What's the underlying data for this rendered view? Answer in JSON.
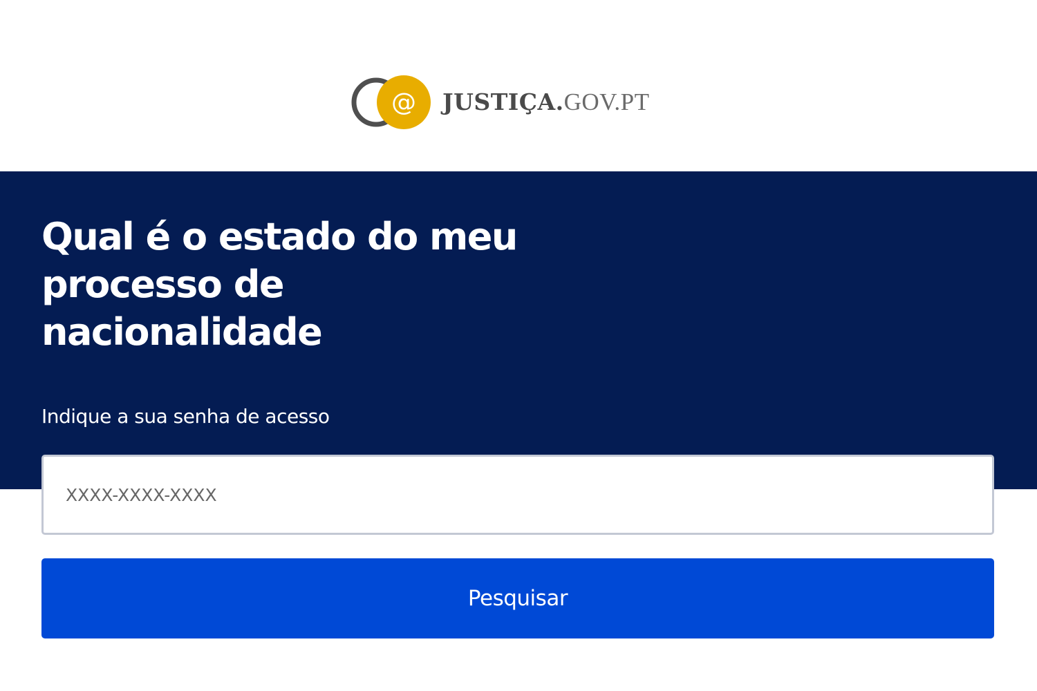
{
  "logo": {
    "icon": "justica-at-logo-icon",
    "brand": "JUSTIÇA.",
    "domain": "GOV.PT",
    "colors": {
      "ring": "#4f4f4f",
      "circle": "#e8ad00",
      "at_symbol": "#ffffff"
    }
  },
  "hero": {
    "title": "Qual é o estado do meu processo de nacionalidade",
    "background_color": "#041c53"
  },
  "form": {
    "label": "Indique a sua senha de acesso",
    "input_placeholder": "XXXX-XXXX-XXXX",
    "input_value": "",
    "submit_label": "Pesquisar",
    "submit_color": "#0049d6"
  }
}
